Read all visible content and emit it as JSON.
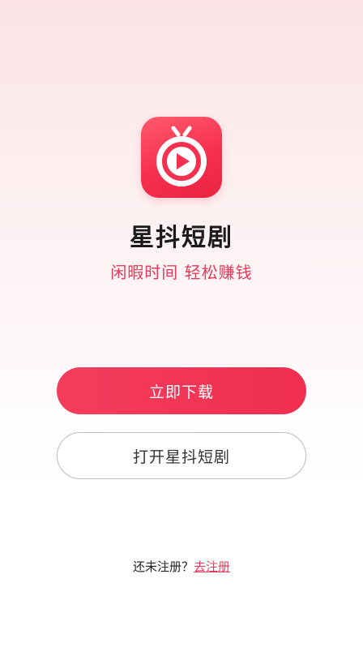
{
  "app": {
    "name": "星抖短剧",
    "slogan": "闲暇时间 轻松赚钱",
    "icon": "play-tv-icon"
  },
  "actions": {
    "download_label": "立即下载",
    "open_label": "打开星抖短剧"
  },
  "register": {
    "prompt": "还未注册？",
    "link_label": "去注册"
  },
  "colors": {
    "accent": "#f02e50",
    "slogan": "#e83a5a",
    "title": "#1a1a1a"
  }
}
